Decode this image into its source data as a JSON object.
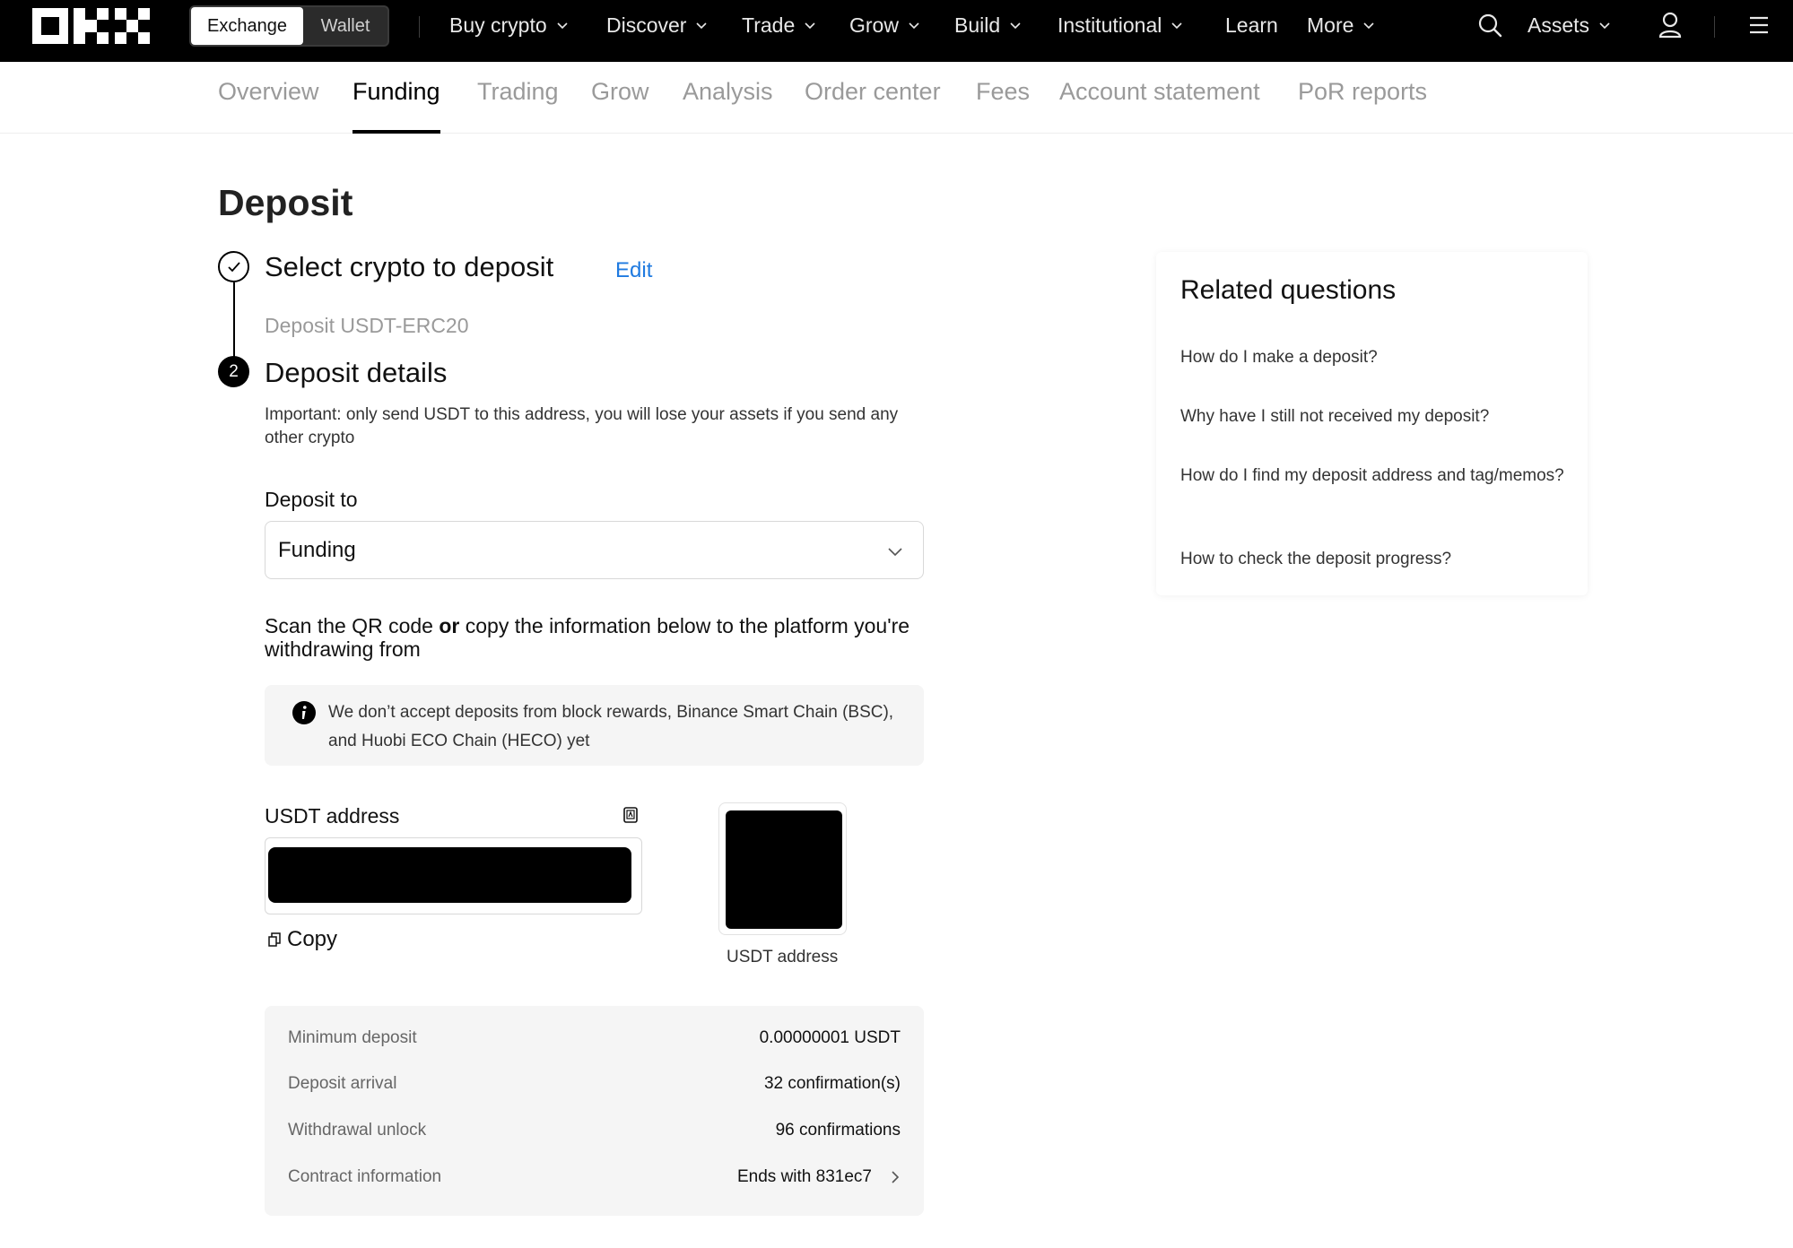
{
  "topnav": {
    "brand": "OKX",
    "switch": {
      "exchange": "Exchange",
      "wallet": "Wallet"
    },
    "items": [
      {
        "label": "Buy crypto",
        "dropdown": true
      },
      {
        "label": "Discover",
        "dropdown": true
      },
      {
        "label": "Trade",
        "dropdown": true
      },
      {
        "label": "Grow",
        "dropdown": true
      },
      {
        "label": "Build",
        "dropdown": true
      },
      {
        "label": "Institutional",
        "dropdown": true
      },
      {
        "label": "Learn",
        "dropdown": false
      },
      {
        "label": "More",
        "dropdown": true
      }
    ],
    "assets": "Assets",
    "icons": [
      "search-icon",
      "user-icon",
      "menu-icon"
    ]
  },
  "subtabs": {
    "items": [
      "Overview",
      "Funding",
      "Trading",
      "Grow",
      "Analysis",
      "Order center",
      "Fees",
      "Account statement",
      "PoR reports"
    ],
    "active": "Funding"
  },
  "page": {
    "title": "Deposit"
  },
  "steps": {
    "step1": {
      "title": "Select crypto to deposit",
      "edit": "Edit",
      "summary": "Deposit USDT-ERC20"
    },
    "step2": {
      "number": "2",
      "title": "Deposit details"
    }
  },
  "details": {
    "warning": "Important: only send USDT to this address, you will lose your assets if you send any other crypto",
    "deposit_to_label": "Deposit to",
    "deposit_to_value": "Funding",
    "scan_text_1": "Scan the QR code ",
    "scan_text_or": "or",
    "scan_text_2": " copy the information below to the platform you're withdrawing from",
    "notice": "We don’t accept deposits from block rewards, Binance Smart Chain (BSC), and Huobi ECO Chain (HECO) yet",
    "address_label": "USDT address",
    "copy": "Copy",
    "qr_caption": "USDT address"
  },
  "info_rows": [
    {
      "label": "Minimum deposit",
      "value": "0.00000001 USDT"
    },
    {
      "label": "Deposit arrival",
      "value": "32 confirmation(s)"
    },
    {
      "label": "Withdrawal unlock",
      "value": "96 confirmations"
    },
    {
      "label": "Contract information",
      "value": "Ends with 831ec7"
    }
  ],
  "related": {
    "title": "Related questions",
    "questions": [
      "How do I make a deposit?",
      "Why have I still not received my deposit?",
      "How do I find my deposit address and tag/memos?",
      "How to check the deposit progress?"
    ]
  },
  "colors": {
    "accent": "#1f7ae0",
    "nav_bg": "#000000",
    "panel_bg": "#f5f5f5"
  }
}
